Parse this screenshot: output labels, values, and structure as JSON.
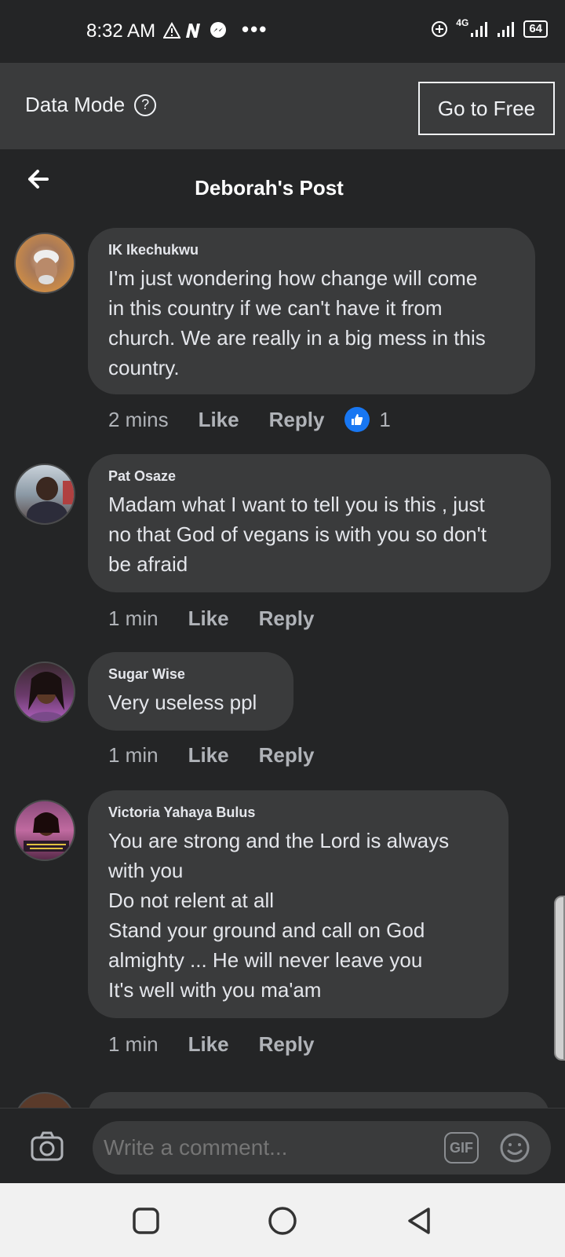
{
  "status_bar": {
    "time": "8:32 AM",
    "dots": "•••",
    "network": "4G",
    "battery": "64"
  },
  "banner": {
    "label": "Data Mode",
    "help_symbol": "?",
    "button": "Go to Free"
  },
  "header": {
    "title": "Deborah's Post"
  },
  "comments": [
    {
      "name": "IK Ikechukwu",
      "text": "I'm just wondering how change will come\nin this country if we can't have it from\nchurch. We are really in a big mess in this\ncountry.",
      "time": "2 mins",
      "like": "Like",
      "reply": "Reply",
      "reaction_count": "1"
    },
    {
      "name": "Pat Osaze",
      "text": "Madam what I want to tell you is this , just\nno that God of vegans is with you so don't\nbe afraid",
      "time": "1 min",
      "like": "Like",
      "reply": "Reply"
    },
    {
      "name": "Sugar Wise",
      "text": "Very useless ppl",
      "time": "1 min",
      "like": "Like",
      "reply": "Reply"
    },
    {
      "name": "Victoria Yahaya Bulus",
      "text": "You are strong and the Lord is always\nwith you\nDo not relent at all\nStand your ground and call on God\nalmighty ... He will never leave you\nIt's well with you ma'am",
      "time": "1 min",
      "like": "Like",
      "reply": "Reply"
    }
  ],
  "composer": {
    "placeholder": "Write a comment...",
    "gif_label": "GIF"
  },
  "colors": {
    "background": "#242526",
    "bubble": "#3a3b3c",
    "like_blue": "#1877f2"
  }
}
